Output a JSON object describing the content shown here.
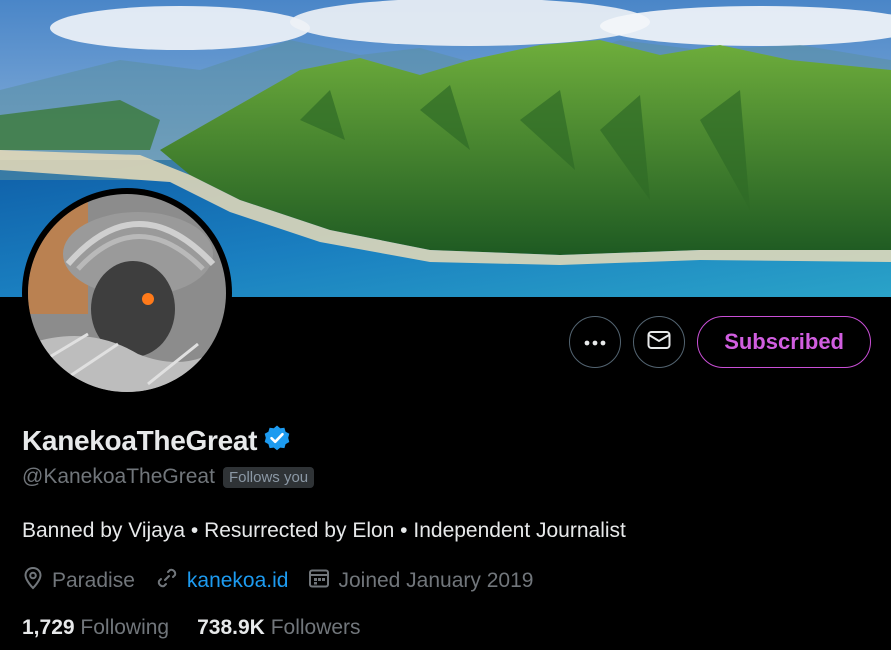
{
  "profile": {
    "display_name": "KanekoaTheGreat",
    "handle": "@KanekoaTheGreat",
    "follows_you": "Follows you",
    "bio": "Banned by Vijaya • Resurrected by Elon • Independent Journalist",
    "location": "Paradise",
    "website": "kanekoa.id",
    "joined": "Joined January 2019",
    "following_count": "1,729",
    "following_label": "Following",
    "followers_count": "738.9K",
    "followers_label": "Followers"
  },
  "actions": {
    "more_icon": "ellipsis-icon",
    "message_icon": "mail-icon",
    "subscribe_label": "Subscribed"
  },
  "colors": {
    "accent_subscribe": "#d15ee0",
    "link": "#1d9bf0",
    "verified": "#1d9bf0",
    "muted": "#71767b"
  }
}
